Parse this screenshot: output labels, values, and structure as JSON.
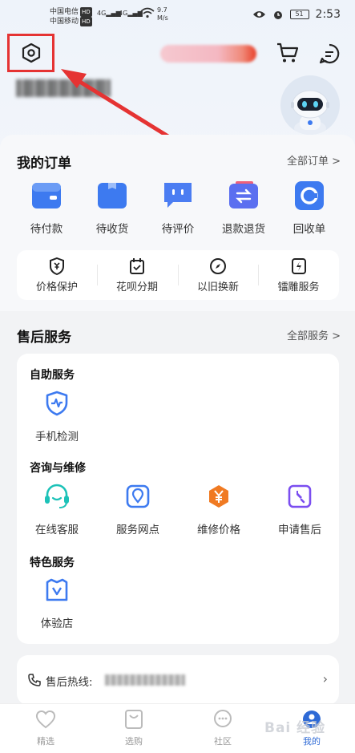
{
  "status_bar": {
    "carrier1": "中国电信",
    "carrier2": "中国移动",
    "hd": "HD",
    "sig1": "4G",
    "sig2": "4G",
    "net_speed_value": "9.7",
    "net_speed_unit": "M/s",
    "battery": "51",
    "time": "2:53"
  },
  "orders": {
    "title": "我的订单",
    "more": "全部订单 >",
    "items": [
      {
        "label": "待付款",
        "color": "#3d7af0"
      },
      {
        "label": "待收货",
        "color": "#3d7af0"
      },
      {
        "label": "待评价",
        "color": "#4b7df2"
      },
      {
        "label": "退款退货",
        "color": "#5b6ff0"
      },
      {
        "label": "回收单",
        "color": "#3d7af0"
      }
    ],
    "sub_items": [
      {
        "label": "价格保护",
        "icon": "shield-yen-icon"
      },
      {
        "label": "花呗分期",
        "icon": "calendar-check-icon"
      },
      {
        "label": "以旧换新",
        "icon": "compass-icon"
      },
      {
        "label": "镭雕服务",
        "icon": "lightning-icon"
      }
    ]
  },
  "after_sales": {
    "title": "售后服务",
    "more": "全部服务 >",
    "self_service": {
      "title": "自助服务",
      "items": [
        {
          "label": "手机检测",
          "icon": "pulse-shield-icon",
          "color": "#3d7af0"
        }
      ]
    },
    "consult": {
      "title": "咨询与维修",
      "items": [
        {
          "label": "在线客服",
          "icon": "headset-icon",
          "color": "#1cc2b8"
        },
        {
          "label": "服务网点",
          "icon": "location-icon",
          "color": "#3d7af0"
        },
        {
          "label": "维修价格",
          "icon": "hexagon-yen-icon",
          "color": "#f07a22"
        },
        {
          "label": "申请售后",
          "icon": "wrench-icon",
          "color": "#7b4ef0"
        }
      ]
    },
    "featured": {
      "title": "特色服务",
      "items": [
        {
          "label": "体验店",
          "icon": "store-icon",
          "color": "#3d7af0"
        }
      ]
    }
  },
  "hotline": {
    "label": "售后热线:"
  },
  "bottom_nav": {
    "items": [
      {
        "label": "精选",
        "icon": "heart-icon"
      },
      {
        "label": "选购",
        "icon": "shopping-bag-icon"
      },
      {
        "label": "社区",
        "icon": "chat-bubble-icon"
      },
      {
        "label": "我的",
        "icon": "profile-icon"
      }
    ],
    "active_color": "#2e6ad6"
  },
  "watermark": "Bai 经验",
  "colors": {
    "highlight_box": "#e53333",
    "arrow": "#e53333"
  }
}
